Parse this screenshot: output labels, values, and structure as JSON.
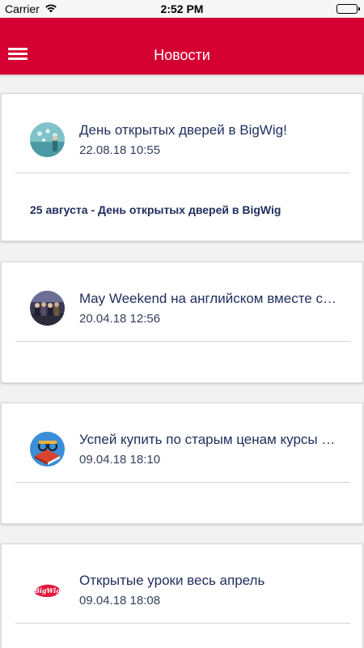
{
  "status_bar": {
    "carrier": "Carrier",
    "time": "2:52 PM"
  },
  "app_bar": {
    "title": "Новости",
    "menu_icon": "hamburger-menu-icon",
    "color": "#d50032"
  },
  "news": [
    {
      "title": "День открытых дверей в BigWig!",
      "date": "22.08.18 10:55",
      "excerpt": "25 августа - День открытых дверей в BigWig"
    },
    {
      "title": "May Weekend на английском вместе с BigWig",
      "date": "20.04.18 12:56",
      "excerpt": ""
    },
    {
      "title": "Успей купить по старым ценам курсы BigWig",
      "date": "09.04.18 18:10",
      "excerpt": ""
    },
    {
      "title": "Открытые уроки весь апрель",
      "date": "09.04.18 18:08",
      "excerpt": "",
      "logo_text": "BigWig"
    }
  ]
}
